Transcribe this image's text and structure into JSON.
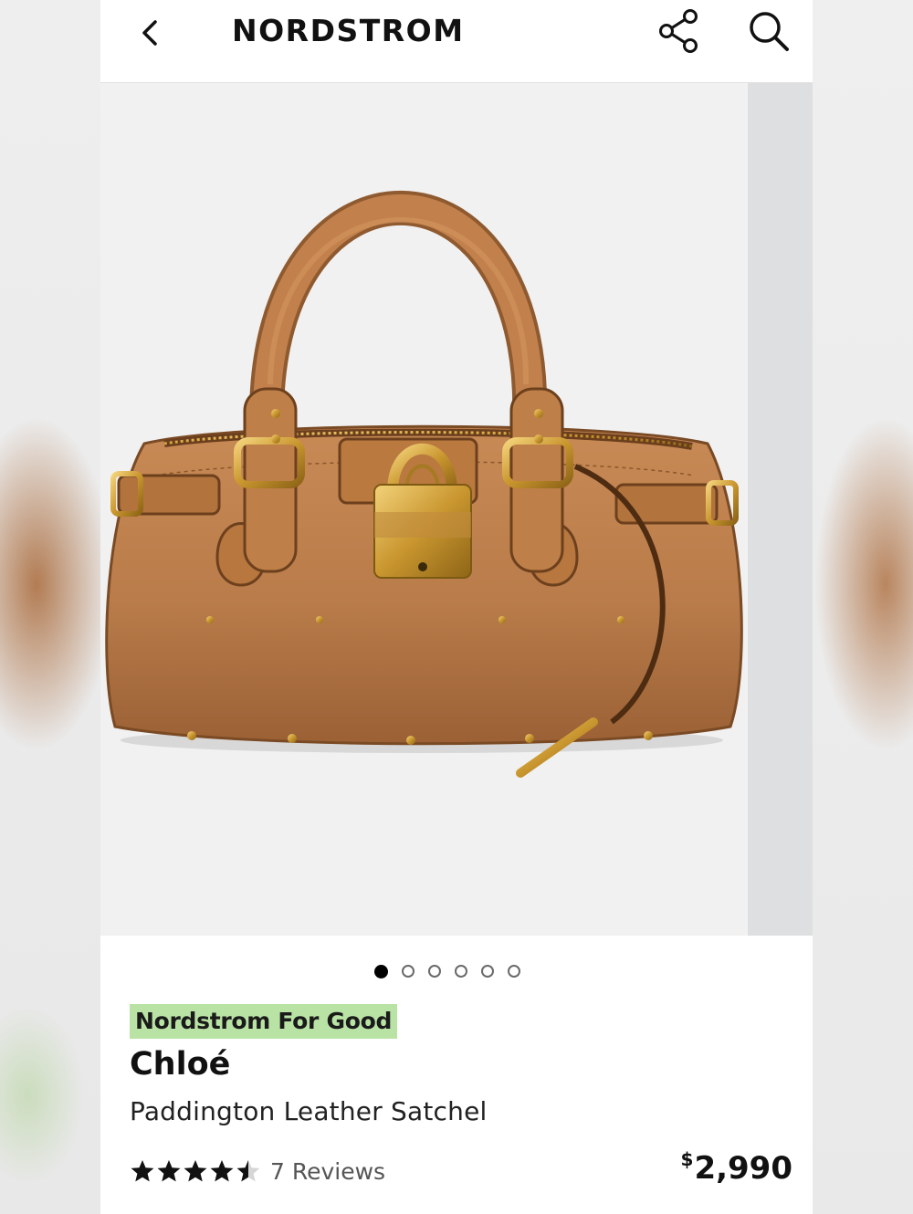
{
  "header": {
    "brand": "NORDSTROM",
    "back_icon": "chevron-left-icon",
    "share_icon": "share-icon",
    "search_icon": "search-icon"
  },
  "gallery": {
    "image_count": 6,
    "active_index": 0,
    "product_color": "#b97c4a"
  },
  "product": {
    "badge": "Nordstrom For Good",
    "badge_color": "#b9e3a4",
    "brand": "Chloé",
    "name": "Paddington Leather Satchel",
    "rating": 4.5,
    "rating_max": 5,
    "reviews": "7 Reviews",
    "price_symbol": "$",
    "price": "2,990"
  }
}
